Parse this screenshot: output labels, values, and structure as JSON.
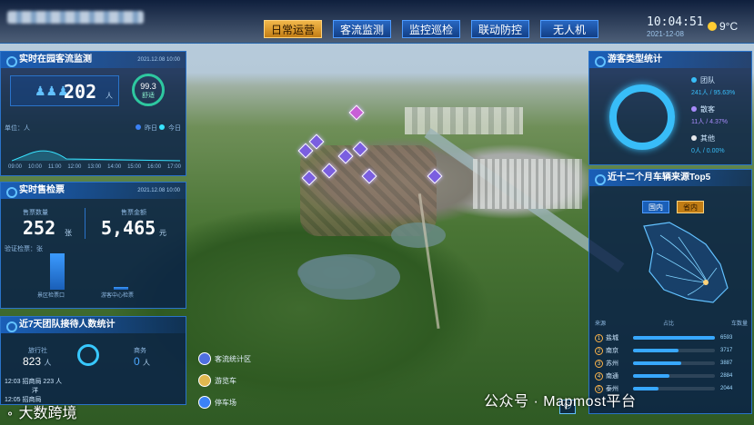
{
  "nav": {
    "tabs": [
      {
        "label": "日常运营",
        "active": true
      },
      {
        "label": "客流监测",
        "active": false
      },
      {
        "label": "监控巡检",
        "active": false
      },
      {
        "label": "联动防控",
        "active": false
      },
      {
        "label": "无人机",
        "active": false
      }
    ]
  },
  "status": {
    "time": "10:04:51",
    "date": "2021-12-08",
    "temperature": "9°C"
  },
  "realtime_visitors": {
    "title": "实时在园客流监测",
    "date": "2021.12.08 10:00",
    "count": "202",
    "unit": "人",
    "comfort_value": "99.3",
    "comfort_label": "舒适",
    "unit_caption": "单位：人",
    "legend_yesterday": "昨日",
    "legend_today": "今日",
    "hours": [
      "09:00",
      "10:00",
      "11:00",
      "12:00",
      "13:00",
      "14:00",
      "15:00",
      "16:00",
      "17:00"
    ]
  },
  "ticket_check": {
    "title": "实时售检票",
    "date": "2021.12.08 10:00",
    "sold_label": "售票数量",
    "sold_value": "252",
    "sold_unit": "张",
    "amount_label": "售票金额",
    "amount_value": "5,465",
    "amount_unit": "元",
    "checked_caption": "验证检票：张",
    "bar_labels": [
      "景区检票口",
      "游客中心检票"
    ],
    "bar_values": [
      30,
      2
    ]
  },
  "group_stats": {
    "title": "近7天团队接待人数统计",
    "agency_label": "旅行社",
    "agency_value": "823",
    "agency_unit": "人",
    "company_label": "商务",
    "company_value": "0",
    "company_unit": "人",
    "row1": "12:03 招商局",
    "row1_value": "223 人",
    "row1_extra": "洋",
    "row2": "12:05 招商局"
  },
  "map_legend": [
    {
      "label": "客流统计区",
      "icon": "flow-area-icon",
      "color": "#4f6fe0"
    },
    {
      "label": "游览车",
      "icon": "tour-bus-icon",
      "color": "#e0b84f"
    },
    {
      "label": "停车场",
      "icon": "parking-icon",
      "color": "#3b82f6"
    }
  ],
  "visitor_type": {
    "title": "游客类型统计",
    "items": [
      {
        "label": "团队",
        "value": "241人 / 95.63%",
        "color": "#38bdf8"
      },
      {
        "label": "散客",
        "value": "11人 / 4.37%",
        "color": "#a78bfa"
      },
      {
        "label": "其他",
        "value": "0人 / 0.00%",
        "color": "#e5e7eb"
      }
    ]
  },
  "vehicle_source": {
    "title": "近十二个月车辆来源Top5",
    "tab_domestic": "国内",
    "tab_province": "省内",
    "col_source": "来源",
    "col_share": "占比",
    "col_count": "车数量",
    "rows": [
      {
        "rank": "1",
        "city": "盐城",
        "count": "6593",
        "share": 1.0
      },
      {
        "rank": "2",
        "city": "南京",
        "count": "3717",
        "share": 0.56
      },
      {
        "rank": "3",
        "city": "苏州",
        "count": "3887",
        "share": 0.59
      },
      {
        "rank": "4",
        "city": "南通",
        "count": "2884",
        "share": 0.44
      },
      {
        "rank": "5",
        "city": "泰州",
        "count": "2044",
        "share": 0.31
      }
    ]
  },
  "watermark": "公众号 · Mapmost平台",
  "brand": "大数跨境"
}
